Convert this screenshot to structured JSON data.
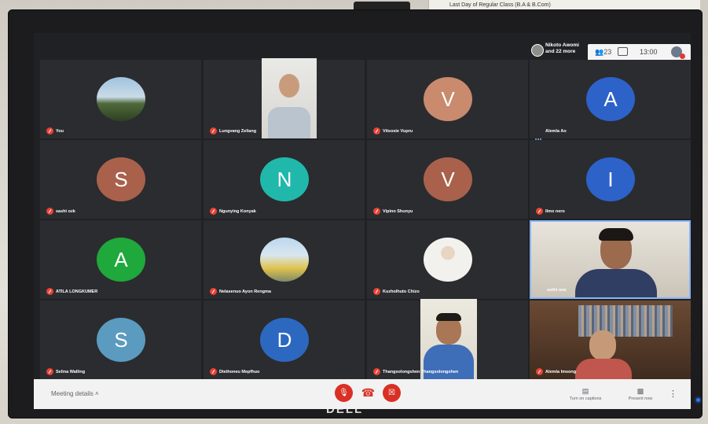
{
  "paper": {
    "text": "Last Day of Regular Class (B.A & B.Com)"
  },
  "brand": "DELL",
  "host": {
    "name": "Nikoto Awomi",
    "more": "and 22 more"
  },
  "top_controls": {
    "people_count": "23",
    "time": "13:00"
  },
  "tiles": [
    {
      "name": "You",
      "muted": true
    },
    {
      "name": "Lungvang Zeliang",
      "muted": true
    },
    {
      "name": "Vitsosie Vupru",
      "muted": true,
      "initial": "V",
      "color": "#c98a6e"
    },
    {
      "name": "Alemla Ao",
      "muted": false,
      "initial": "A",
      "color": "#2d62c9"
    },
    {
      "name": "sashi ozk",
      "muted": true,
      "initial": "S",
      "color": "#a9614b"
    },
    {
      "name": "Ngunying Konyak",
      "muted": true,
      "initial": "N",
      "color": "#21b8ac"
    },
    {
      "name": "Vipino Shunyu",
      "muted": true,
      "initial": "V",
      "color": "#a9614b"
    },
    {
      "name": "Ilmo nero",
      "muted": true,
      "initial": "I",
      "color": "#2d62c9"
    },
    {
      "name": "ATILA LONGKUMER",
      "muted": true,
      "initial": "A",
      "color": "#1fa83c"
    },
    {
      "name": "Nelasenuo Ayon Rengma",
      "muted": true
    },
    {
      "name": "Kuzholhuto Chizo",
      "muted": true
    },
    {
      "name": "sothi rem",
      "muted": false
    },
    {
      "name": "Selina Walling",
      "muted": true,
      "initial": "S",
      "color": "#5b9bc0"
    },
    {
      "name": "Diethoneu Mepfhuo",
      "muted": true,
      "initial": "D",
      "color": "#2d68c0"
    },
    {
      "name": "Thangsolongshen Thangsolongshen",
      "muted": true
    },
    {
      "name": "Alemla Imsong",
      "muted": true
    }
  ],
  "bottom": {
    "meeting_details": "Meeting details",
    "captions": "Turn on captions",
    "present": "Present now"
  }
}
